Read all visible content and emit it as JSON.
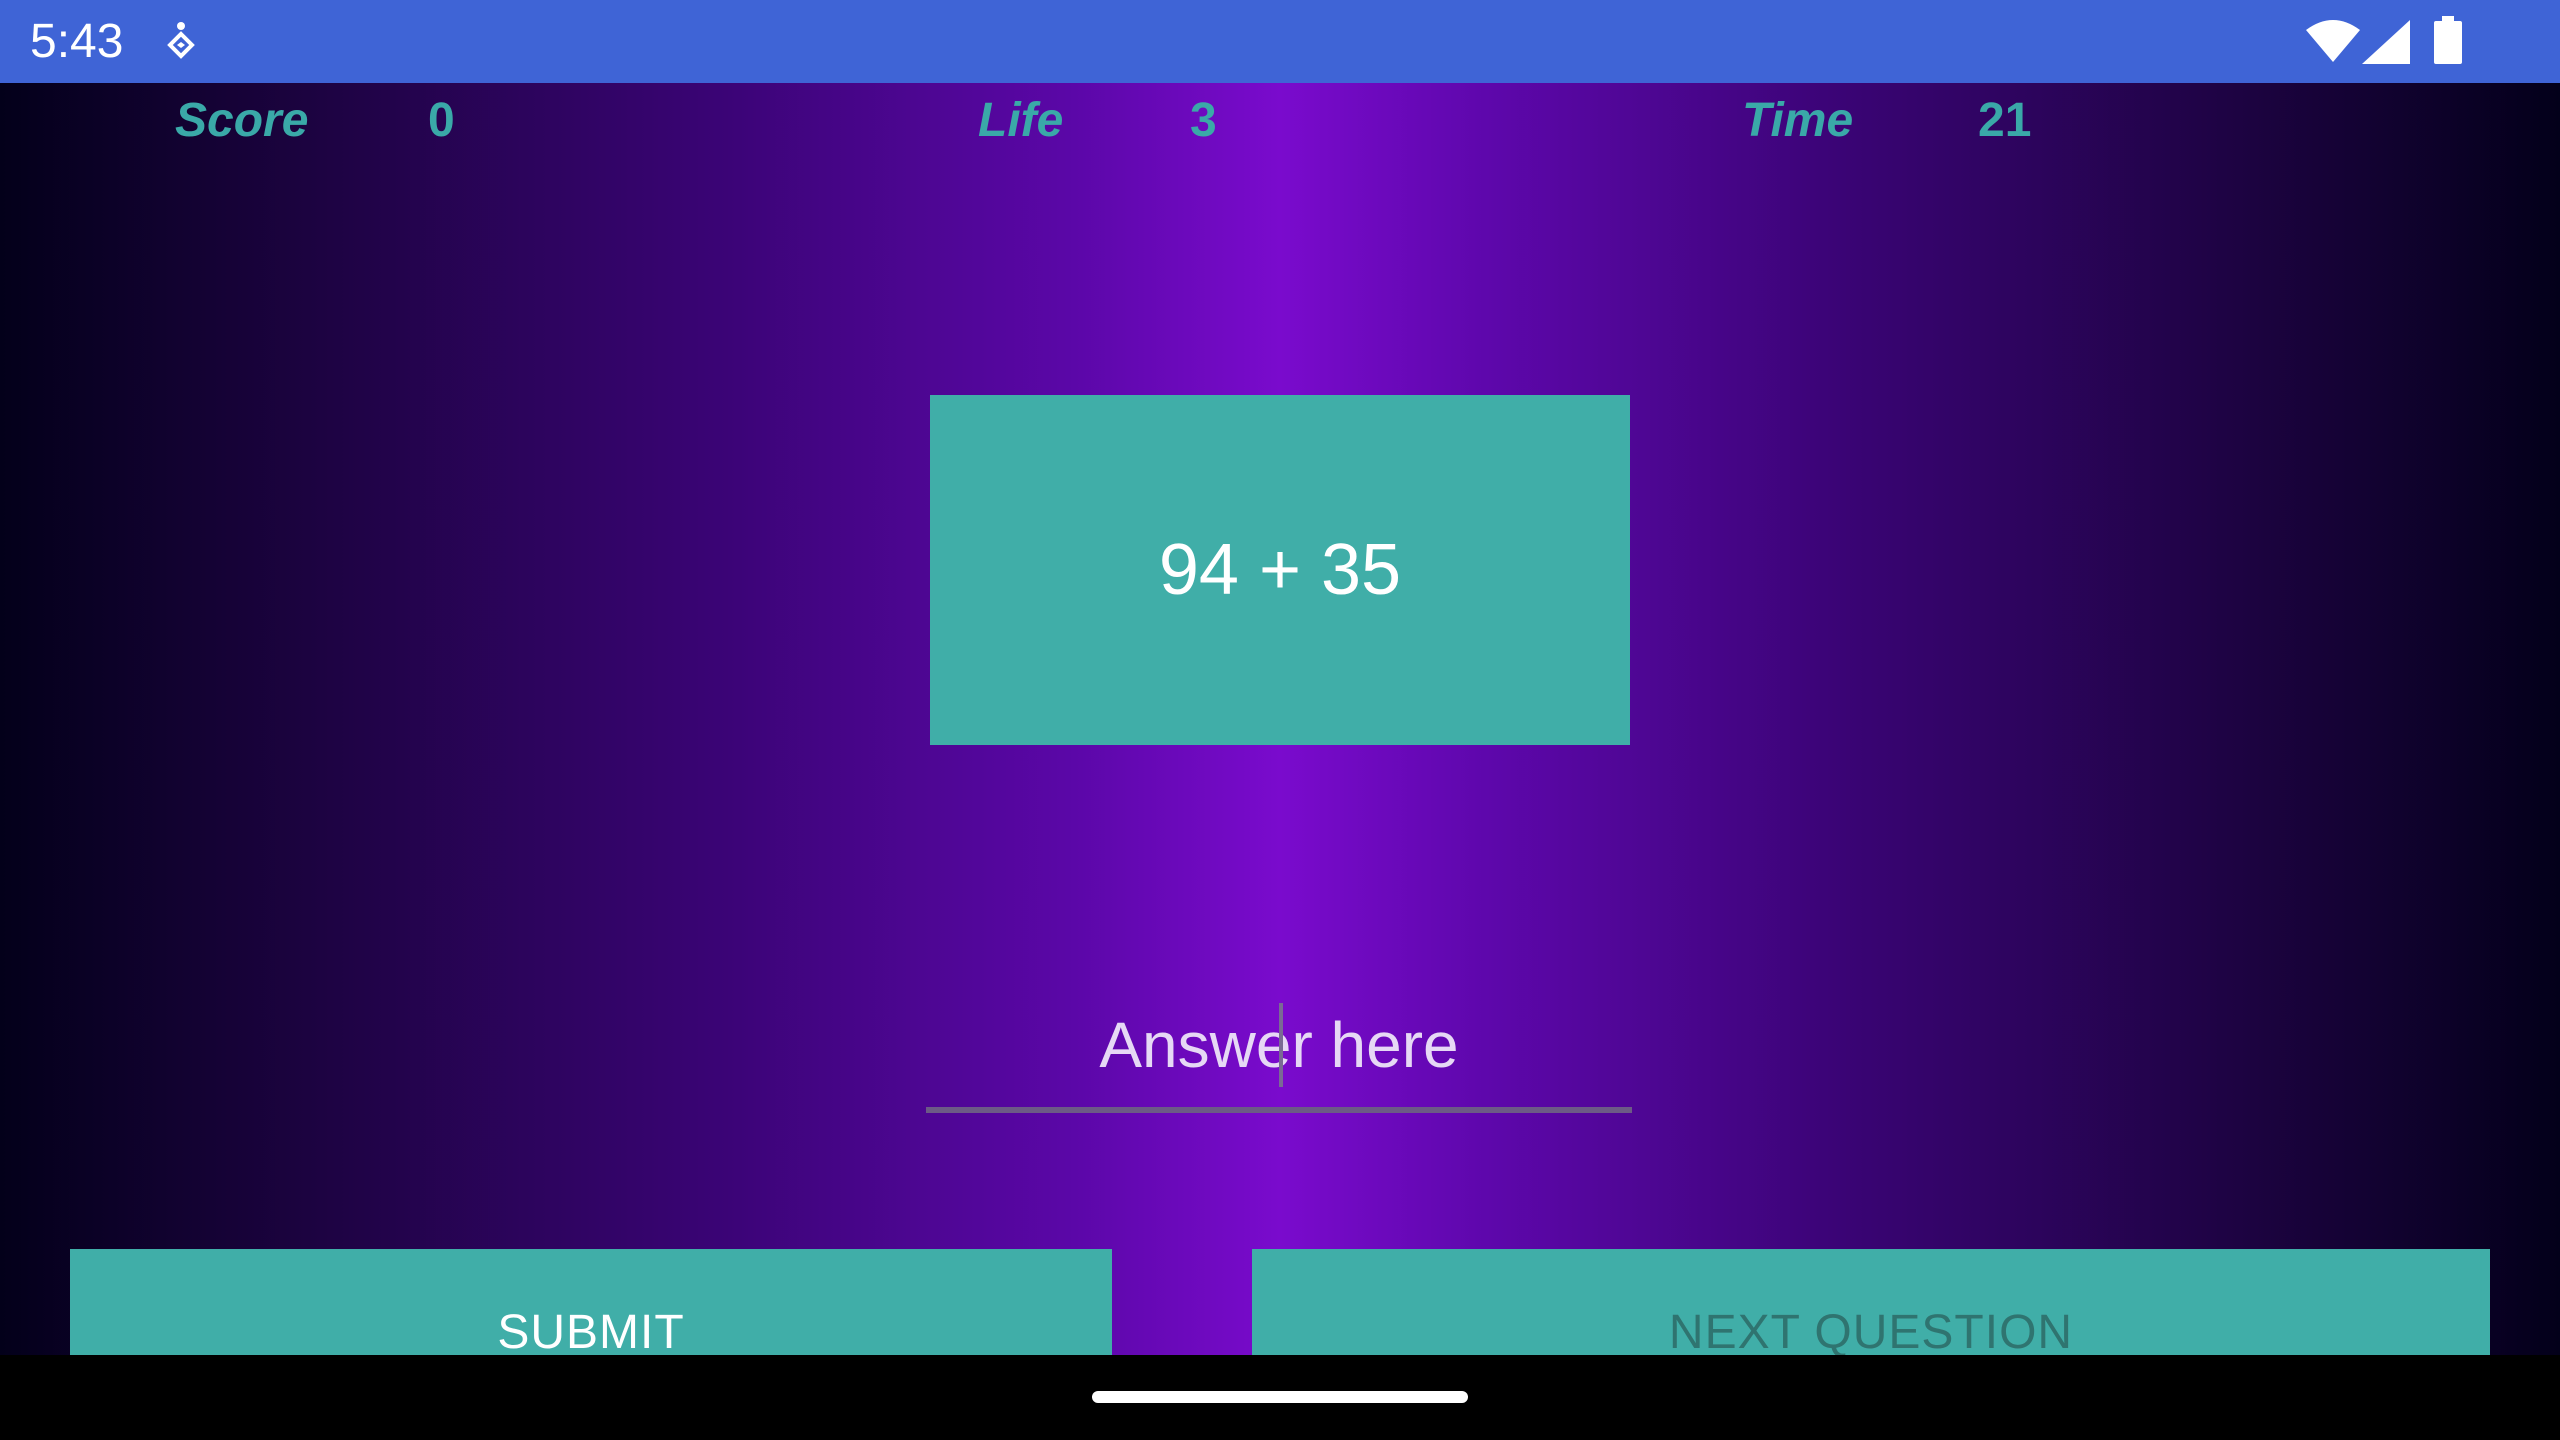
{
  "status_bar": {
    "time": "5:43",
    "notification_icon": "accessibility-icon",
    "wifi_icon": "wifi-icon",
    "signal_icon": "cell-signal-icon",
    "battery_icon": "battery-icon",
    "background_color": "#3f64d6"
  },
  "hud": {
    "score_label": "Score",
    "score_value": "0",
    "life_label": "Life",
    "life_value": "3",
    "time_label": "Time",
    "time_value": "21",
    "text_color": "#3aa9a8"
  },
  "question": {
    "text": "94 + 35",
    "box_color": "#40aea8"
  },
  "answer": {
    "value": "",
    "placeholder": "Answer here"
  },
  "buttons": {
    "submit_label": "SUBMIT",
    "next_label": "NEXT QUESTION",
    "color": "#40aea8"
  },
  "navigation": {
    "home_handle": "home-gesture-handle"
  }
}
